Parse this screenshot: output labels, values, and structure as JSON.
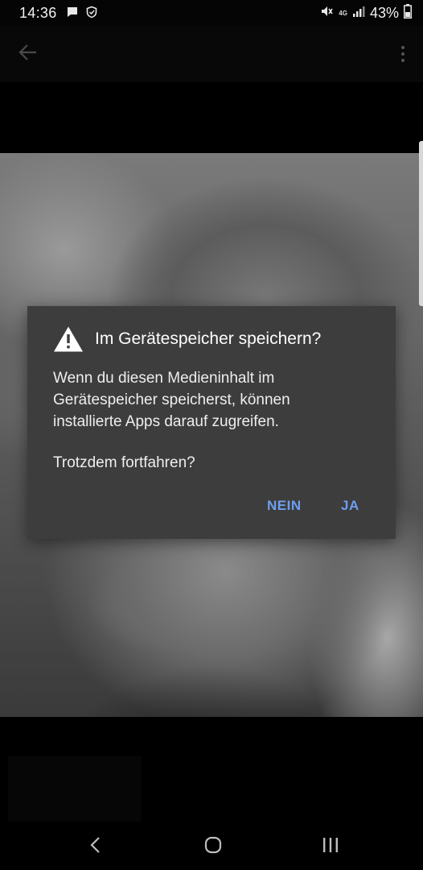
{
  "status_bar": {
    "time": "14:36",
    "network": "4G",
    "battery": "43%",
    "icons": [
      "message-icon",
      "shield-icon",
      "mute-icon",
      "signal-icon",
      "battery-icon"
    ]
  },
  "app_bar": {
    "icons": [
      "back-arrow-icon",
      "more-vert-icon"
    ]
  },
  "dialog": {
    "title": "Im Gerätespeicher speichern?",
    "body_lines": [
      "Wenn du diesen Medieninhalt im",
      "Gerätespeicher speicherst, können",
      "installierte Apps darauf zugreifen."
    ],
    "question": "Trotzdem fortfahren?",
    "no_label": "NEIN",
    "yes_label": "JA",
    "accent_color": "#6d9ef0",
    "background_color": "#3d3d3d"
  },
  "nav_bar": {
    "icons": [
      "nav-back-icon",
      "nav-home-icon",
      "nav-recent-icon"
    ]
  }
}
